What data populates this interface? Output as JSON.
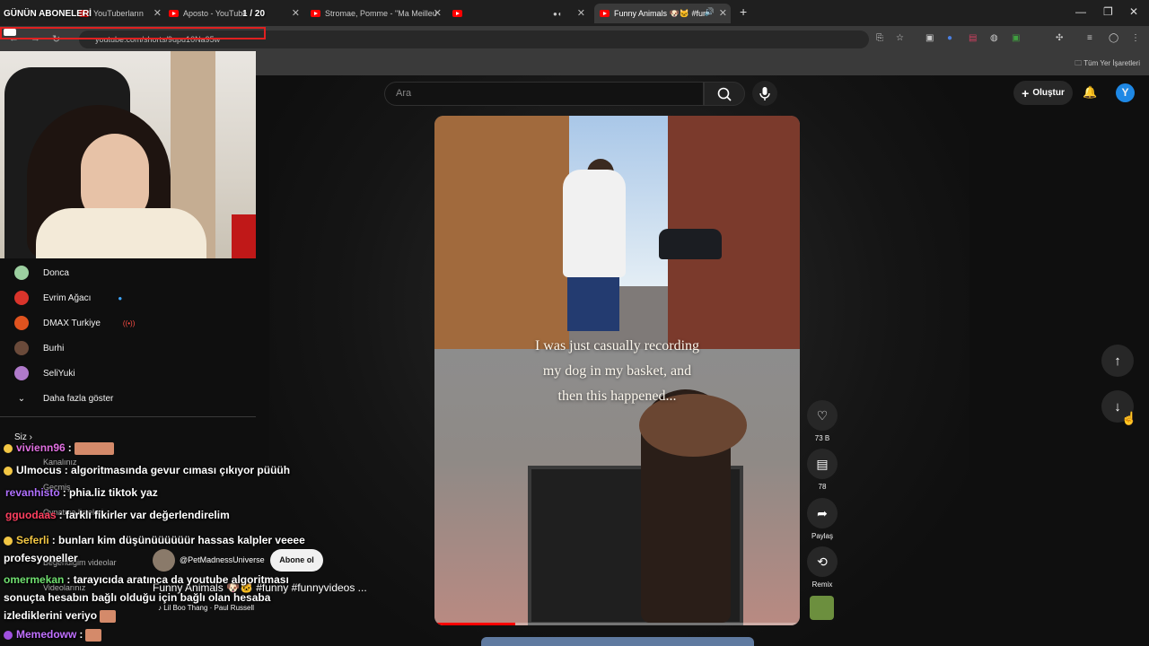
{
  "browser": {
    "tabs": [
      {
        "label": "YouTuberların",
        "active": false
      },
      {
        "label": "Aposto - YouTube",
        "active": false
      },
      {
        "label": "Stromae, Pomme - \"Ma Meilleu",
        "active": false
      },
      {
        "label": "",
        "active": false
      },
      {
        "label": "",
        "active": false
      },
      {
        "label": "Funny Animals 🐶🐱 #fun",
        "active": true
      }
    ],
    "new_tab": "+",
    "url": "youtube.com/shorts/9upu10Na95w",
    "bookmarks_all": "Tüm Yer İşaretleri",
    "window_controls": [
      "—",
      "❐",
      "✕"
    ]
  },
  "overlay": {
    "title": "GÜNÜN ABONELERİ",
    "count": "1 / 20"
  },
  "youtube": {
    "search_placeholder": "Ara",
    "create_label": "Oluştur",
    "avatar_letter": "Y"
  },
  "sidebar": {
    "channels": [
      {
        "name": "Donca",
        "color": "#9ccfa0",
        "badge": ""
      },
      {
        "name": "Evrim Ağacı",
        "color": "#d9342b",
        "badge": "dot"
      },
      {
        "name": "DMAX Turkiye",
        "color": "#e0531f",
        "badge": "live"
      },
      {
        "name": "Burhi",
        "color": "#6a4a3a",
        "badge": ""
      },
      {
        "name": "SeliYuki",
        "color": "#b07acb",
        "badge": ""
      }
    ],
    "show_more": "Daha fazla göster",
    "you_section": "Siz",
    "you_items": [
      "Kanalınız",
      "Geçmiş",
      "Oynatma listeleri",
      "Beğendiğim videolar",
      "Videolarınız"
    ]
  },
  "short": {
    "caption_lines": [
      "I was just casually recording",
      "my dog in my basket, and",
      "then this happened..."
    ],
    "progress": 0.22,
    "likes": "73 B",
    "comments": "78",
    "share": "Paylaş",
    "remix": "Remix",
    "channel": "@PetMadnessUniverse",
    "subscribe": "Abone ol",
    "title": "Funny Animals 🐶🐱 #funny #funnyvideos ...",
    "music": "♪ Lil Boo Thang · Paul Russell"
  },
  "chat": [
    {
      "user": "vivienn96",
      "user_color": "#e070e0",
      "text": ":",
      "emote": true
    },
    {
      "user": "Ulmocus",
      "user_color": "#ffffff",
      "text": ": algoritmasında gevur cıması çıkıyor püüüh",
      "emote": false
    },
    {
      "user": "revanhisto",
      "user_color": "#b070ff",
      "text": ": phia.liz tiktok yaz",
      "emote": false
    },
    {
      "user": "gguodaas",
      "user_color": "#ff4060",
      "text": ": farklı fikirler var değerlendirelim",
      "emote": false
    },
    {
      "user": "Seferli",
      "user_color": "#f3c744",
      "text": ": bunları kim düşünüüüüüür hassas kalpler veeee profesyoneller",
      "emote": false
    },
    {
      "user": "omermekan",
      "user_color": "#70e070",
      "text": ": tarayıcıda aratınca da youtube algoritması sonuçta hesabın bağlı olduğu için bağlı olan hesaba izlediklerini veriyo",
      "emote": true
    },
    {
      "user": "Memedoww",
      "user_color": "#c070ff",
      "text": ":",
      "emote": true
    }
  ]
}
